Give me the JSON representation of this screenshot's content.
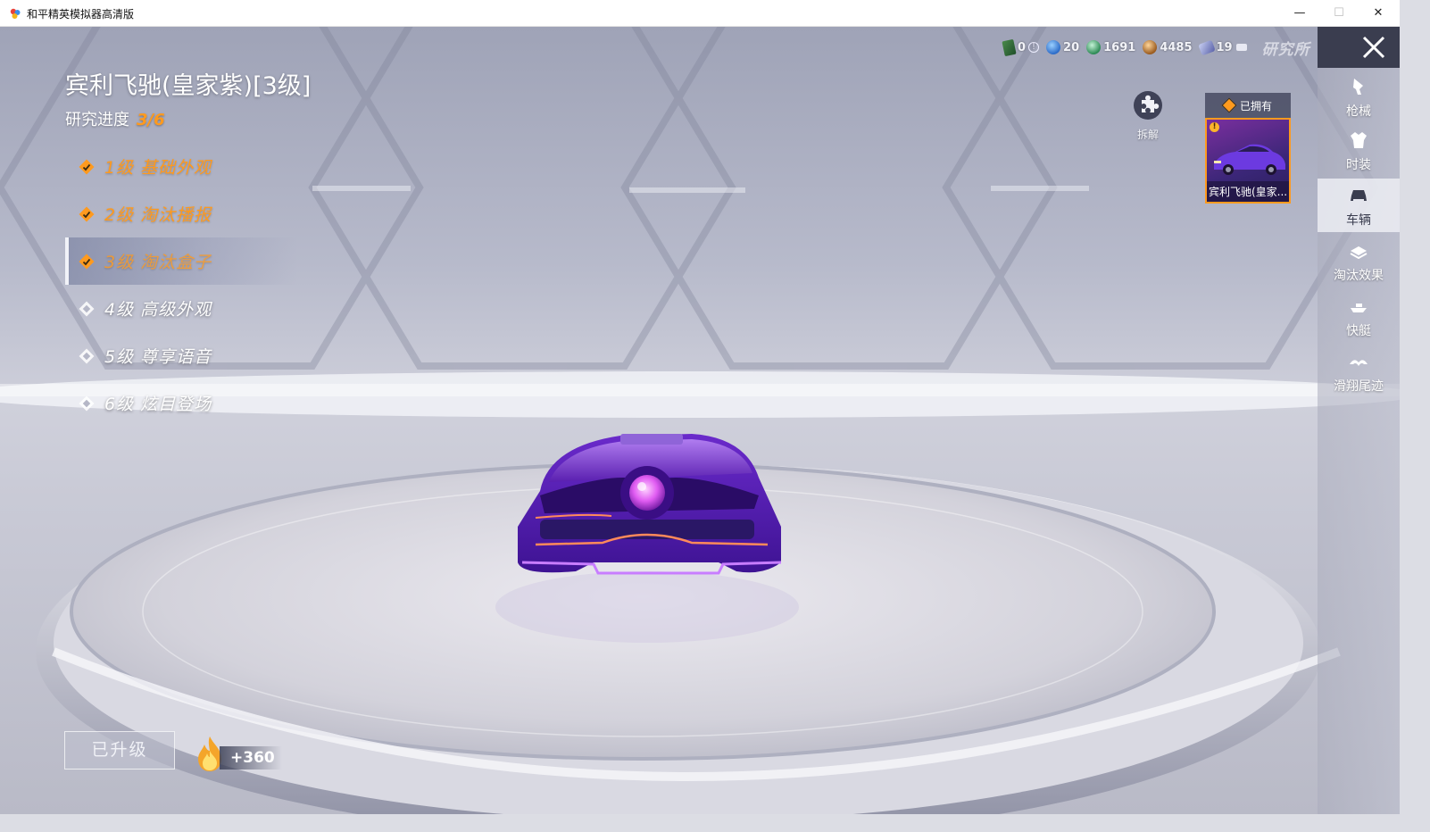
{
  "window": {
    "title": "和平精英模拟器高清版",
    "min_glyph": "—",
    "max_glyph": "☐",
    "close_glyph": "✕"
  },
  "currency": [
    {
      "icon": "card-icon",
      "value": "0",
      "sub": "!"
    },
    {
      "icon": "globe-coin-icon",
      "value": "20"
    },
    {
      "icon": "emerald-coin-icon",
      "value": "1691"
    },
    {
      "icon": "bronze-coin-icon",
      "value": "4485"
    },
    {
      "icon": "ticket-icon",
      "value": "19"
    }
  ],
  "section_label": "研究所",
  "item": {
    "title": "宾利飞驰(皇家紫)[3级]",
    "progress_label": "研究进度",
    "progress_value": "3/6"
  },
  "levels": [
    {
      "label": "1级 基础外观",
      "state": "done"
    },
    {
      "label": "2级 淘汰播报",
      "state": "done"
    },
    {
      "label": "3级 淘汰盒子",
      "state": "active"
    },
    {
      "label": "4级 高级外观",
      "state": "todo"
    },
    {
      "label": "5级 尊享语音",
      "state": "todo"
    },
    {
      "label": "6级 炫目登场",
      "state": "todo"
    }
  ],
  "upgrade_button": "已升级",
  "flame_amount": "+360",
  "disassemble_label": "拆解",
  "owned": {
    "tag": "已拥有",
    "badge": "!",
    "car_name": "宾利飞驰(皇家..."
  },
  "sidebar": [
    {
      "label": "枪械",
      "icon": "gun-icon"
    },
    {
      "label": "时装",
      "icon": "outfit-icon"
    },
    {
      "label": "车辆",
      "icon": "vehicle-icon",
      "active": true
    },
    {
      "label": "淘汰效果",
      "icon": "elimination-icon"
    },
    {
      "label": "快艇",
      "icon": "speedboat-icon"
    },
    {
      "label": "滑翔尾迹",
      "icon": "glider-trail-icon"
    }
  ],
  "colors": {
    "accent_orange": "#ff9a1e",
    "sidebar_dark": "#3a3d4f",
    "model_purple": "#5b1fb0",
    "model_glow": "#e27bff"
  }
}
